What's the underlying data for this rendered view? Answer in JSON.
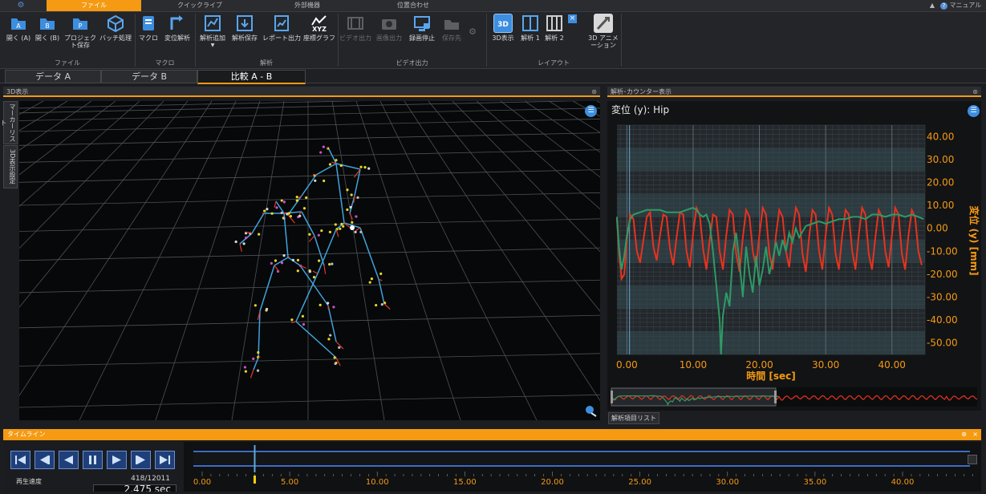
{
  "top_tabs": [
    {
      "label": "",
      "icon": "gear-icon"
    },
    {
      "label": "ファイル",
      "active": true
    },
    {
      "label": "クイックライブ"
    },
    {
      "label": "外部機器"
    },
    {
      "label": "位置合わせ"
    }
  ],
  "top_right": {
    "help_label": "マニュアル"
  },
  "ribbon": {
    "buttons": [
      {
        "label": "開く (A)",
        "icon": "open-a-icon",
        "enabled": true
      },
      {
        "label": "開く (B)",
        "icon": "open-b-icon",
        "enabled": true
      },
      {
        "label": "プロジェクト保存",
        "icon": "project-save-icon",
        "enabled": true
      },
      {
        "label": "バッチ処理",
        "icon": "batch-icon",
        "enabled": true
      },
      {
        "label": "マクロ",
        "icon": "macro-icon",
        "enabled": true
      },
      {
        "label": "変位解析",
        "icon": "displacement-icon",
        "enabled": true
      },
      {
        "label": "解析追加",
        "icon": "analysis-add-icon",
        "enabled": true
      },
      {
        "label": "解析保存",
        "icon": "analysis-save-icon",
        "enabled": true
      },
      {
        "label": "レポート出力",
        "icon": "report-icon",
        "enabled": true
      },
      {
        "label": "座標グラフ",
        "icon": "xyz-graph-icon",
        "enabled": true
      },
      {
        "label": "ビデオ出力",
        "icon": "video-out-icon",
        "enabled": false
      },
      {
        "label": "画像出力",
        "icon": "image-out-icon",
        "enabled": false
      },
      {
        "label": "録画停止",
        "icon": "rec-stop-icon",
        "enabled": true
      },
      {
        "label": "保存先",
        "icon": "save-dest-icon",
        "enabled": false
      },
      {
        "label": "3D表示",
        "icon": "3d-view-icon",
        "enabled": true
      },
      {
        "label": "解析 1",
        "icon": "layout-1-icon",
        "enabled": true
      },
      {
        "label": "解析 2",
        "icon": "layout-2-icon",
        "enabled": true
      },
      {
        "label": "3D アニメーション",
        "icon": "3d-animation-icon",
        "enabled": true
      }
    ],
    "groups": [
      "ファイル",
      "マクロ",
      "解析",
      "ビデオ出力",
      "レイアウト"
    ],
    "xyz_text": "XYZ",
    "three_d_text": "3D"
  },
  "doc_tabs": [
    {
      "label": "データ A"
    },
    {
      "label": "データ B"
    },
    {
      "label": "比較 A - B",
      "active": true
    }
  ],
  "panels": {
    "view3d_title": "3D表示",
    "analysis_title": "解析･カウンター表示",
    "side_tabs": [
      "マーカーリスト",
      "3D表示設定"
    ],
    "list_tab": "解析項目リスト"
  },
  "chart_data": {
    "type": "line",
    "title": "変位 (y):  Hip",
    "xlabel": "時間 [sec]",
    "ylabel": "変位 (y) [mm]",
    "xlim": [
      -1.5,
      45
    ],
    "ylim": [
      -55,
      45
    ],
    "x_ticks": [
      "0.00",
      "10.00",
      "20.00",
      "30.00",
      "40.00"
    ],
    "y_ticks": [
      "40.00",
      "30.00",
      "20.00",
      "10.00",
      "0.00",
      "-10.00",
      "-20.00",
      "-30.00",
      "-40.00",
      "-50.00"
    ],
    "grid": true,
    "series": [
      {
        "color": "#e8321e",
        "values": [
          [
            -1.5,
            4
          ],
          [
            -1.2,
            -10
          ],
          [
            -0.8,
            -22
          ],
          [
            -0.4,
            -20
          ],
          [
            0,
            -5
          ],
          [
            0.5,
            6
          ],
          [
            1,
            4
          ],
          [
            1.5,
            -10
          ],
          [
            2,
            -15
          ],
          [
            2.5,
            -5
          ],
          [
            3,
            5
          ],
          [
            3.5,
            7
          ],
          [
            4,
            -8
          ],
          [
            4.5,
            -14
          ],
          [
            5,
            -3
          ],
          [
            5.5,
            6
          ],
          [
            6,
            5
          ],
          [
            6.5,
            -9
          ],
          [
            7,
            -16
          ],
          [
            7.5,
            -4
          ],
          [
            8,
            7
          ],
          [
            8.5,
            6
          ],
          [
            9,
            -10
          ],
          [
            9.5,
            -17
          ],
          [
            10,
            -2
          ],
          [
            10.5,
            9
          ],
          [
            11,
            6
          ],
          [
            11.5,
            -9
          ],
          [
            12,
            -18
          ],
          [
            12.5,
            -5
          ],
          [
            13,
            6
          ],
          [
            13.5,
            5
          ],
          [
            14,
            -10
          ],
          [
            14.5,
            -18
          ],
          [
            15,
            -3
          ],
          [
            15.5,
            8
          ],
          [
            16,
            6
          ],
          [
            16.5,
            -11
          ],
          [
            17,
            -19
          ],
          [
            17.5,
            -4
          ],
          [
            18,
            8
          ],
          [
            18.5,
            5
          ],
          [
            19,
            -10
          ],
          [
            19.5,
            -17
          ],
          [
            20,
            -3
          ],
          [
            20.5,
            9
          ],
          [
            21,
            6
          ],
          [
            21.5,
            -11
          ],
          [
            22,
            -18
          ],
          [
            22.5,
            -3
          ],
          [
            23,
            8
          ],
          [
            23.5,
            5
          ],
          [
            24,
            -10
          ],
          [
            24.5,
            -17
          ],
          [
            25,
            -2
          ],
          [
            25.5,
            9
          ],
          [
            26,
            6
          ],
          [
            26.5,
            -11
          ],
          [
            27,
            -19
          ],
          [
            27.5,
            -4
          ],
          [
            28,
            8
          ],
          [
            28.5,
            6
          ],
          [
            29,
            -10
          ],
          [
            29.5,
            -18
          ],
          [
            30,
            -3
          ],
          [
            30.5,
            9
          ],
          [
            31,
            6
          ],
          [
            31.5,
            -11
          ],
          [
            32,
            -18
          ],
          [
            32.5,
            -3
          ],
          [
            33,
            8
          ],
          [
            33.5,
            6
          ],
          [
            34,
            -10
          ],
          [
            34.5,
            -18
          ],
          [
            35,
            -3
          ],
          [
            35.5,
            9
          ],
          [
            36,
            6
          ],
          [
            36.5,
            -11
          ],
          [
            37,
            -18
          ],
          [
            37.5,
            -4
          ],
          [
            38,
            8
          ],
          [
            38.5,
            5
          ],
          [
            39,
            -10
          ],
          [
            39.5,
            -17
          ],
          [
            40,
            -3
          ],
          [
            40.5,
            9
          ],
          [
            41,
            6
          ],
          [
            41.5,
            -11
          ],
          [
            42,
            -18
          ],
          [
            42.5,
            -3
          ],
          [
            43,
            8
          ],
          [
            43.5,
            5
          ],
          [
            44,
            -10
          ],
          [
            44.5,
            -16
          ]
        ]
      },
      {
        "color": "#2e9a66",
        "values": [
          [
            -1.5,
            5
          ],
          [
            -1.2,
            -8
          ],
          [
            -0.8,
            -18
          ],
          [
            -0.4,
            -12
          ],
          [
            0,
            -3
          ],
          [
            0.5,
            4
          ],
          [
            1,
            6
          ],
          [
            2,
            7
          ],
          [
            3,
            8
          ],
          [
            4,
            8
          ],
          [
            5,
            8
          ],
          [
            6,
            7
          ],
          [
            7,
            7
          ],
          [
            8,
            7
          ],
          [
            9,
            8
          ],
          [
            10,
            9
          ],
          [
            10.5,
            8
          ],
          [
            11,
            6
          ],
          [
            11.5,
            5
          ],
          [
            12,
            6
          ],
          [
            12.5,
            2
          ],
          [
            13,
            -10
          ],
          [
            13.5,
            -25
          ],
          [
            14,
            -40
          ],
          [
            14.2,
            -55
          ],
          [
            14.5,
            -38
          ],
          [
            15,
            -28
          ],
          [
            15.5,
            -34
          ],
          [
            16,
            -10
          ],
          [
            16.5,
            -2
          ],
          [
            17,
            -15
          ],
          [
            17.5,
            -30
          ],
          [
            18,
            -8
          ],
          [
            18.5,
            -20
          ],
          [
            19,
            -28
          ],
          [
            19.5,
            -12
          ],
          [
            20,
            -25
          ],
          [
            20.5,
            -18
          ],
          [
            21,
            -8
          ],
          [
            21.5,
            -20
          ],
          [
            22,
            -14
          ],
          [
            22.5,
            -6
          ],
          [
            23,
            -12
          ],
          [
            23.5,
            -5
          ],
          [
            24,
            -10
          ],
          [
            24.5,
            -2
          ],
          [
            25,
            -6
          ],
          [
            25.5,
            0
          ],
          [
            26,
            -4
          ],
          [
            27,
            1
          ],
          [
            28,
            2
          ],
          [
            29,
            3
          ],
          [
            30,
            2
          ],
          [
            31,
            3
          ],
          [
            32,
            4
          ],
          [
            33,
            4
          ],
          [
            34,
            5
          ],
          [
            35,
            5
          ],
          [
            36,
            4
          ],
          [
            37,
            6
          ],
          [
            38,
            6
          ],
          [
            39,
            5
          ],
          [
            40,
            6
          ],
          [
            41,
            6
          ],
          [
            42,
            5
          ],
          [
            43,
            6
          ],
          [
            44,
            5
          ],
          [
            44.8,
            4
          ]
        ]
      }
    ]
  },
  "timeline": {
    "title": "タイムライン",
    "speed_label": "再生速度",
    "frame_counter": "418/12011",
    "current_time": "2.475 sec",
    "current_x": 3.0,
    "x_ticks": [
      "0.00",
      "5.00",
      "10.00",
      "15.00",
      "20.00",
      "25.00",
      "30.00",
      "35.00",
      "40.00"
    ],
    "controls": [
      "skip-start-icon",
      "step-back-icon",
      "play-back-icon",
      "pause-icon",
      "play-icon",
      "step-forward-icon",
      "skip-end-icon"
    ]
  }
}
